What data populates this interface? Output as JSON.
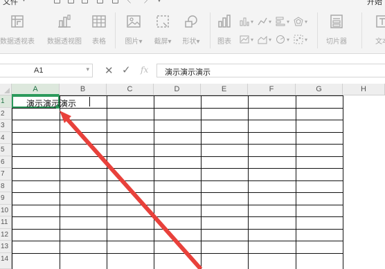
{
  "ribbon": {
    "file_tab": "文件",
    "start_tab": "开始",
    "buttons": [
      {
        "label": "数据透视表",
        "icon": "pivot-table-icon"
      },
      {
        "label": "数据透视图",
        "icon": "pivot-chart-icon"
      },
      {
        "label": "表格",
        "icon": "table-icon"
      },
      {
        "label": "图片",
        "icon": "picture-icon"
      },
      {
        "label": "截屏",
        "icon": "screenshot-icon"
      },
      {
        "label": "形状",
        "icon": "shape-icon"
      },
      {
        "label": "图表",
        "icon": "chart-icon"
      },
      {
        "label": "切片器",
        "icon": "slicer-icon"
      },
      {
        "label": "文本",
        "icon": "textbox-icon"
      }
    ]
  },
  "formula_bar": {
    "name_box": "A1",
    "fx": "fx",
    "content": "演示演示演示"
  },
  "sheet": {
    "columns": [
      "A",
      "B",
      "C",
      "D",
      "E",
      "F",
      "G",
      "H"
    ],
    "rows": [
      "1",
      "2",
      "3",
      "4",
      "5",
      "6",
      "7",
      "8",
      "9",
      "10",
      "11",
      "12",
      "13",
      "14"
    ],
    "active_cell": "A1",
    "a1_value": "演示演示演示"
  },
  "colors": {
    "selection": "#2c9a5c",
    "annotation_arrow": "#e8413b",
    "ribbon_bg": "#f4f4f4",
    "header_bg": "#eeeeee"
  }
}
